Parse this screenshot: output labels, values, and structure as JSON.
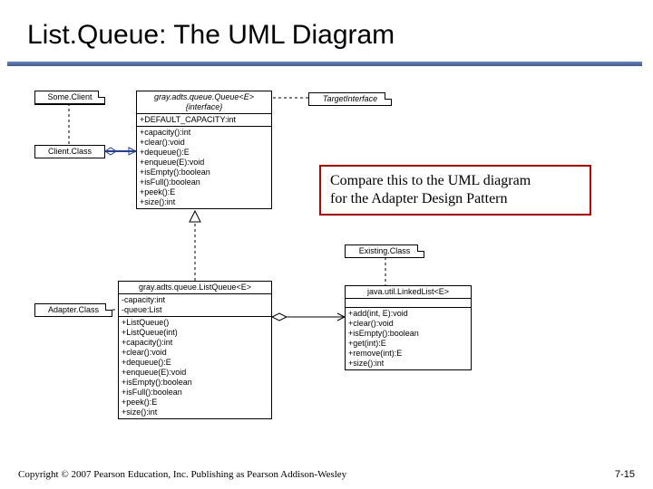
{
  "title": "List.Queue: The UML Diagram",
  "callout": {
    "line1": "Compare this to the UML diagram",
    "line2": "for the Adapter Design Pattern"
  },
  "boxes": {
    "someClient": {
      "name": "Some.Client"
    },
    "clientClass": {
      "name": "Client.Class"
    },
    "targetInterface": {
      "name": "TargetInterface"
    },
    "queueInterface": {
      "hdr1": "gray.adts.queue.Queue<E>",
      "hdr2": "{interface}",
      "attrs": "+DEFAULT_CAPACITY:int",
      "ops": [
        "+capacity():int",
        "+clear():void",
        "+dequeue():E",
        "+enqueue(E):void",
        "+isEmpty():boolean",
        "+isFull():boolean",
        "+peek():E",
        "+size():int"
      ]
    },
    "adapterClass": {
      "name": "Adapter.Class"
    },
    "existingClass": {
      "name": "Existing.Class"
    },
    "listQueue": {
      "hdr": "gray.adts.queue.ListQueue<E>",
      "attrs": [
        "-capacity:int",
        "-queue:List"
      ],
      "ops": [
        "+ListQueue()",
        "+ListQueue(int)",
        "+capacity():int",
        "+clear():void",
        "+dequeue():E",
        "+enqueue(E):void",
        "+isEmpty():boolean",
        "+isFull():boolean",
        "+peek():E",
        "+size():int"
      ]
    },
    "linkedList": {
      "hdr": "java.util.LinkedList<E>",
      "ops": [
        "+add(int, E):void",
        "+clear():void",
        "+isEmpty():boolean",
        "+get(int):E",
        "+remove(int):E",
        "+size():int"
      ]
    }
  },
  "footer": "Copyright © 2007 Pearson Education, Inc. Publishing as Pearson Addison-Wesley",
  "pagenum": "7-15"
}
